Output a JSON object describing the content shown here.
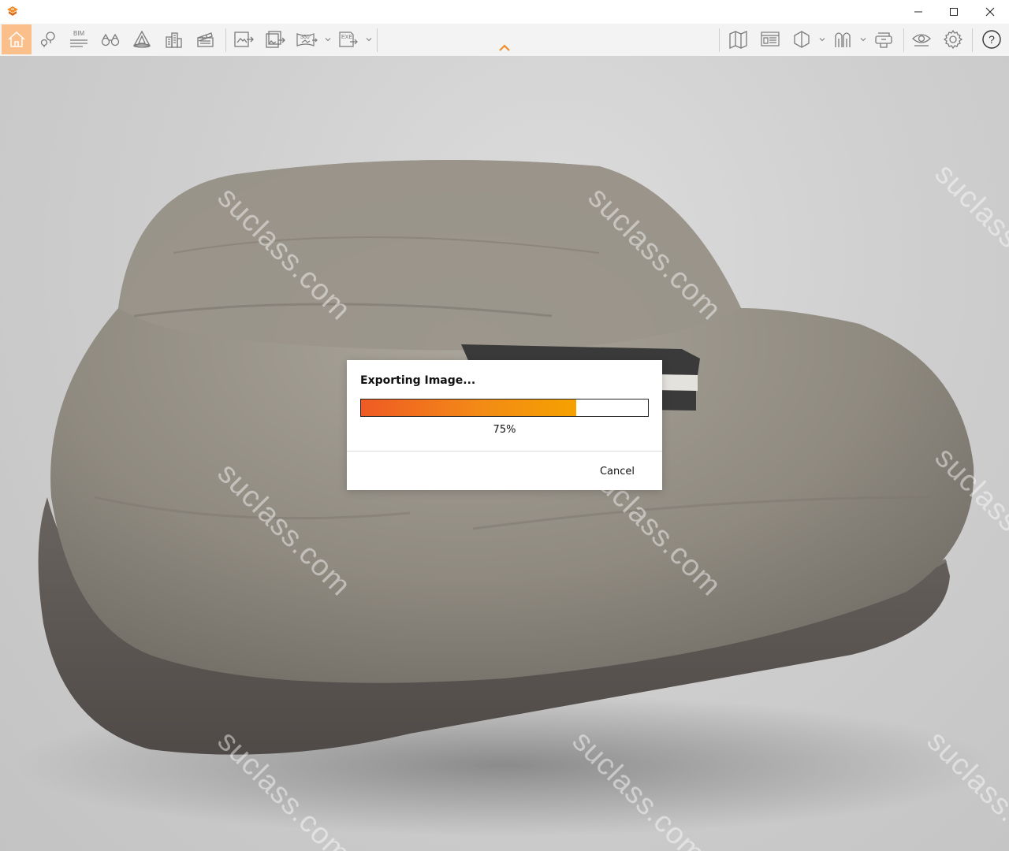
{
  "app": {
    "logo_icon": "enscape-logo-icon",
    "accent_color": "#f28c28"
  },
  "window_controls": {
    "minimize_icon": "minimize-icon",
    "maximize_icon": "maximize-icon",
    "close_icon": "close-icon"
  },
  "toolbar": {
    "left_tools": [
      {
        "icon": "home-icon",
        "active": true
      },
      {
        "icon": "location-pin-icon"
      },
      {
        "icon": "bim-icon",
        "label": "BIM"
      },
      {
        "icon": "binoculars-icon"
      },
      {
        "icon": "asset-library-icon"
      },
      {
        "icon": "buildings-icon"
      },
      {
        "icon": "clapperboard-icon"
      }
    ],
    "export_tools": [
      {
        "icon": "export-image-icon"
      },
      {
        "icon": "batch-export-icon"
      },
      {
        "icon": "panorama-360-icon",
        "label": "360°"
      },
      {
        "icon": "export-exe-icon",
        "label": "EXE"
      }
    ],
    "right_tools": [
      {
        "icon": "map-icon"
      },
      {
        "icon": "render-settings-icon"
      },
      {
        "icon": "view-mode-icon"
      },
      {
        "icon": "section-icon"
      },
      {
        "icon": "vr-headset-icon"
      },
      {
        "icon": "visibility-icon"
      },
      {
        "icon": "settings-gear-icon"
      },
      {
        "icon": "help-icon",
        "label": "?"
      }
    ]
  },
  "viewport": {
    "watermark_text": "suclass.com"
  },
  "dialog": {
    "title": "Exporting Image...",
    "progress_percent": 75,
    "progress_label": "75%",
    "cancel_label": "Cancel",
    "fill_gradient_start": "#ef5a24",
    "fill_gradient_end": "#f5a100"
  }
}
